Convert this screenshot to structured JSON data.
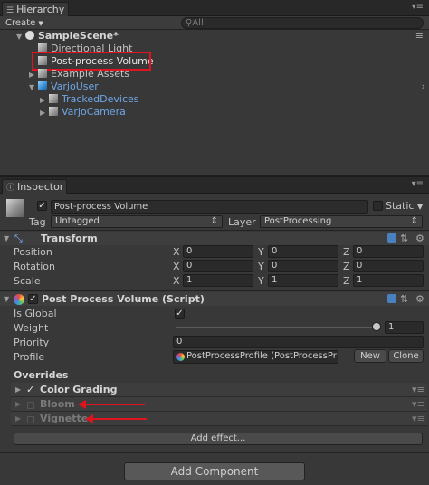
{
  "hierarchy": {
    "tab_label": "Hierarchy",
    "create_label": "Create",
    "search_placeholder": "All",
    "items": [
      {
        "label": "SampleScene*"
      },
      {
        "label": "Directional Light"
      },
      {
        "label": "Post-process Volume"
      },
      {
        "label": "Example Assets"
      },
      {
        "label": "VarjoUser"
      },
      {
        "label": "TrackedDevices"
      },
      {
        "label": "VarjoCamera"
      }
    ]
  },
  "inspector": {
    "tab_label": "Inspector",
    "object_name": "Post-process Volume",
    "static_label": "Static",
    "tag_label": "Tag",
    "tag_value": "Untagged",
    "layer_label": "Layer",
    "layer_value": "PostProcessing",
    "transform": {
      "title": "Transform",
      "position_label": "Position",
      "rotation_label": "Rotation",
      "scale_label": "Scale",
      "axis_x": "X",
      "axis_y": "Y",
      "axis_z": "Z",
      "position": [
        "0",
        "0",
        "0"
      ],
      "rotation": [
        "0",
        "0",
        "0"
      ],
      "scale": [
        "1",
        "1",
        "1"
      ]
    },
    "ppv": {
      "title": "Post Process Volume (Script)",
      "is_global_label": "Is Global",
      "weight_label": "Weight",
      "weight_value": "1",
      "priority_label": "Priority",
      "priority_value": "0",
      "profile_label": "Profile",
      "profile_value": "PostProcessProfile (PostProcessPr",
      "new_label": "New",
      "clone_label": "Clone",
      "overrides_label": "Overrides",
      "overrides": [
        {
          "label": "Color Grading",
          "enabled": true
        },
        {
          "label": "Bloom",
          "enabled": false
        },
        {
          "label": "Vignette",
          "enabled": false
        }
      ],
      "add_effect_label": "Add effect...",
      "check_mark": "✓"
    },
    "add_component_label": "Add Component"
  },
  "colors": {
    "highlight": "#e0141e",
    "panel_bg": "#383838",
    "blue_link": "#6fa7e8"
  }
}
